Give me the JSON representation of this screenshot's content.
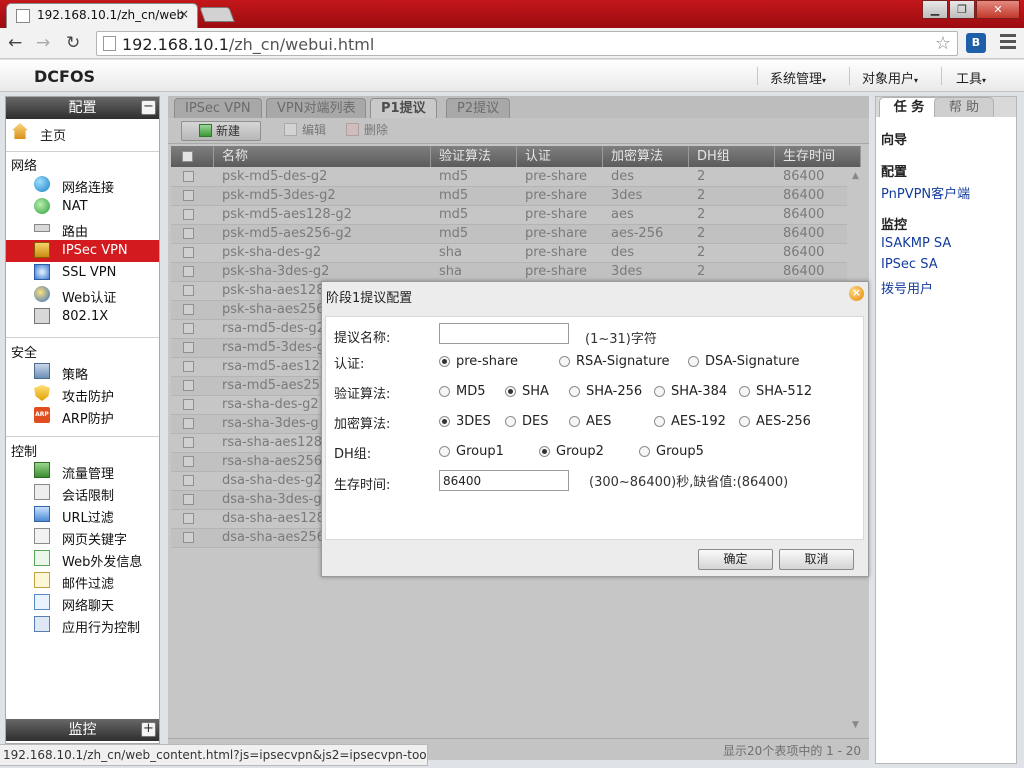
{
  "browser": {
    "tab_title": "192.168.10.1/zh_cn/web",
    "tab_close": "×",
    "url_host": "192.168.10.1",
    "url_path": "/zh_cn/webui.html",
    "status_url": "192.168.10.1/zh_cn/web_content.html?js=ipsecvpn&js2=ipsecvpn-tools#"
  },
  "app": {
    "logo": "DCFOS",
    "menus": [
      "系统管理",
      "对象用户",
      "工具"
    ]
  },
  "sidebar": {
    "config_title": "配置",
    "monitor_title": "监控",
    "collapse_symbol": "−",
    "expand_symbol": "+",
    "home": "主页",
    "groups": [
      {
        "title": "网络",
        "items": [
          "网络连接",
          "NAT",
          "路由",
          "IPSec VPN",
          "SSL VPN",
          "Web认证",
          "802.1X"
        ]
      },
      {
        "title": "安全",
        "items": [
          "策略",
          "攻击防护",
          "ARP防护"
        ]
      },
      {
        "title": "控制",
        "items": [
          "流量管理",
          "会话限制",
          "URL过滤",
          "网页关键字",
          "Web外发信息",
          "邮件过滤",
          "网络聊天",
          "应用行为控制"
        ]
      }
    ],
    "active_item": "IPSec VPN"
  },
  "main": {
    "tabs": [
      "IPSec VPN",
      "VPN对端列表",
      "P1提议",
      "P2提议"
    ],
    "active_tab": "P1提议",
    "actions": {
      "new": "新建",
      "edit": "编辑",
      "delete": "删除"
    },
    "columns": [
      "名称",
      "验证算法",
      "认证",
      "加密算法",
      "DH组",
      "生存时间"
    ],
    "rows": [
      [
        "psk-md5-des-g2",
        "md5",
        "pre-share",
        "des",
        "2",
        "86400"
      ],
      [
        "psk-md5-3des-g2",
        "md5",
        "pre-share",
        "3des",
        "2",
        "86400"
      ],
      [
        "psk-md5-aes128-g2",
        "md5",
        "pre-share",
        "aes",
        "2",
        "86400"
      ],
      [
        "psk-md5-aes256-g2",
        "md5",
        "pre-share",
        "aes-256",
        "2",
        "86400"
      ],
      [
        "psk-sha-des-g2",
        "sha",
        "pre-share",
        "des",
        "2",
        "86400"
      ],
      [
        "psk-sha-3des-g2",
        "sha",
        "pre-share",
        "3des",
        "2",
        "86400"
      ],
      [
        "psk-sha-aes128",
        "",
        "",
        "",
        "",
        ""
      ],
      [
        "psk-sha-aes256",
        "",
        "",
        "",
        "",
        ""
      ],
      [
        "rsa-md5-des-g2",
        "",
        "",
        "",
        "",
        ""
      ],
      [
        "rsa-md5-3des-g",
        "",
        "",
        "",
        "",
        ""
      ],
      [
        "rsa-md5-aes128",
        "",
        "",
        "",
        "",
        ""
      ],
      [
        "rsa-md5-aes256",
        "",
        "",
        "",
        "",
        ""
      ],
      [
        "rsa-sha-des-g2",
        "",
        "",
        "",
        "",
        ""
      ],
      [
        "rsa-sha-3des-g",
        "",
        "",
        "",
        "",
        ""
      ],
      [
        "rsa-sha-aes128",
        "",
        "",
        "",
        "",
        ""
      ],
      [
        "rsa-sha-aes256",
        "",
        "",
        "",
        "",
        ""
      ],
      [
        "dsa-sha-des-g2",
        "",
        "",
        "",
        "",
        ""
      ],
      [
        "dsa-sha-3des-g",
        "",
        "",
        "",
        "",
        ""
      ],
      [
        "dsa-sha-aes128",
        "",
        "",
        "",
        "",
        ""
      ],
      [
        "dsa-sha-aes256",
        "",
        "",
        "",
        "",
        ""
      ]
    ],
    "pager_text": "显示20个表项中的 1 - 20"
  },
  "right_panel": {
    "tabs": [
      "任 务",
      "帮 助"
    ],
    "sections": [
      {
        "title": "向导",
        "links": []
      },
      {
        "title": "配置",
        "links": [
          "PnPVPN客户端"
        ]
      },
      {
        "title": "监控",
        "links": [
          "ISAKMP SA",
          "IPSec SA",
          "拨号用户"
        ]
      }
    ]
  },
  "dialog": {
    "title": "阶段1提议配置",
    "name_label": "提议名称:",
    "name_value": "",
    "name_hint": "(1~31)字符",
    "auth_label": "认证:",
    "auth_options": [
      "pre-share",
      "RSA-Signature",
      "DSA-Signature"
    ],
    "auth_selected": "pre-share",
    "hash_label": "验证算法:",
    "hash_options": [
      "MD5",
      "SHA",
      "SHA-256",
      "SHA-384",
      "SHA-512"
    ],
    "hash_selected": "SHA",
    "enc_label": "加密算法:",
    "enc_options": [
      "3DES",
      "DES",
      "AES",
      "AES-192",
      "AES-256"
    ],
    "enc_selected": "3DES",
    "dh_label": "DH组:",
    "dh_options": [
      "Group1",
      "Group2",
      "Group5"
    ],
    "dh_selected": "Group2",
    "life_label": "生存时间:",
    "life_value": "86400",
    "life_hint": "(300~86400)秒,缺省值:(86400)",
    "ok": "确定",
    "cancel": "取消"
  }
}
